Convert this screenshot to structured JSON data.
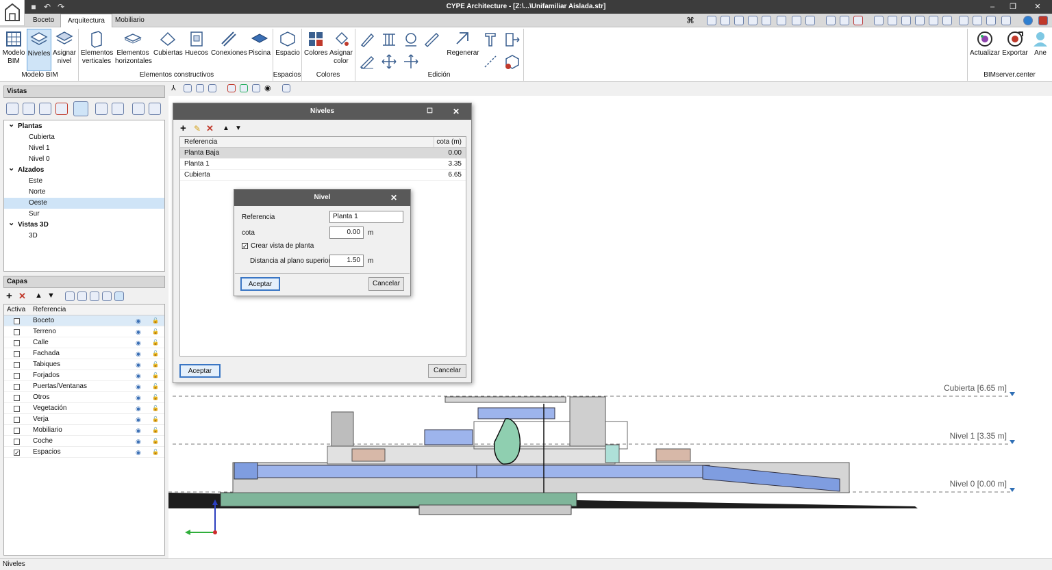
{
  "app": {
    "title": "CYPE Architecture - [Z:\\...\\Unifamiliar Aislada.str]"
  },
  "tabs": [
    "Boceto",
    "Arquitectura",
    "Mobiliario"
  ],
  "ribbon": {
    "modelo_bim": "Modelo BIM",
    "niveles": "Niveles",
    "asignar_nivel": "Asignar nivel",
    "elementos_verticales": "Elementos verticales",
    "elementos_horizontales": "Elementos horizontales",
    "cubiertas": "Cubiertas",
    "huecos": "Huecos",
    "conexiones": "Conexiones",
    "piscina": "Piscina",
    "espacio": "Espacio",
    "colores": "Colores",
    "asignar_color": "Asignar color",
    "regenerar": "Regenerar",
    "actualizar": "Actualizar",
    "exportar": "Exportar",
    "ane": "Ane",
    "groups": {
      "modelo_bim": "Modelo BIM",
      "elementos_constructivos": "Elementos constructivos",
      "espacios": "Espacios",
      "colores": "Colores",
      "edicion": "Edición",
      "bimserver": "BIMserver.center"
    }
  },
  "vistas": {
    "header": "Vistas",
    "tree": [
      {
        "label": "Plantas",
        "group": true
      },
      {
        "label": "Cubierta"
      },
      {
        "label": "Nivel 1"
      },
      {
        "label": "Nivel 0"
      },
      {
        "label": "Alzados",
        "group": true
      },
      {
        "label": "Este"
      },
      {
        "label": "Norte"
      },
      {
        "label": "Oeste",
        "selected": true
      },
      {
        "label": "Sur"
      },
      {
        "label": "Vistas 3D",
        "group": true
      },
      {
        "label": "3D"
      }
    ]
  },
  "capas": {
    "header": "Capas",
    "col_activa": "Activa",
    "col_referencia": "Referencia",
    "rows": [
      {
        "label": "Boceto",
        "checked": false
      },
      {
        "label": "Terreno",
        "checked": false
      },
      {
        "label": "Calle",
        "checked": false
      },
      {
        "label": "Fachada",
        "checked": false
      },
      {
        "label": "Tabiques",
        "checked": false
      },
      {
        "label": "Forjados",
        "checked": false
      },
      {
        "label": "Puertas/Ventanas",
        "checked": false
      },
      {
        "label": "Otros",
        "checked": false
      },
      {
        "label": "Vegetación",
        "checked": false
      },
      {
        "label": "Verja",
        "checked": false
      },
      {
        "label": "Mobiliario",
        "checked": false
      },
      {
        "label": "Coche",
        "checked": false
      },
      {
        "label": "Espacios",
        "checked": true
      }
    ]
  },
  "niveles_dialog": {
    "title": "Niveles",
    "col_referencia": "Referencia",
    "col_cota": "cota (m)",
    "rows": [
      {
        "ref": "Planta Baja",
        "cota": "0.00"
      },
      {
        "ref": "Planta 1",
        "cota": "3.35"
      },
      {
        "ref": "Cubierta",
        "cota": "6.65"
      }
    ],
    "aceptar": "Aceptar",
    "cancelar": "Cancelar"
  },
  "nivel_dialog": {
    "title": "Nivel",
    "referencia_label": "Referencia",
    "referencia_value": "Planta 1",
    "cota_label": "cota",
    "cota_value": "0.00",
    "unit": "m",
    "crear_vista": "Crear vista de planta",
    "distancia_label": "Distancia al plano superior",
    "distancia_value": "1.50",
    "aceptar": "Aceptar",
    "cancelar": "Cancelar"
  },
  "canvas": {
    "levels": [
      "Cubierta [6.65 m]",
      "Nivel 1 [3.35 m]",
      "Nivel 0 [0.00 m]"
    ]
  },
  "status": "Niveles"
}
